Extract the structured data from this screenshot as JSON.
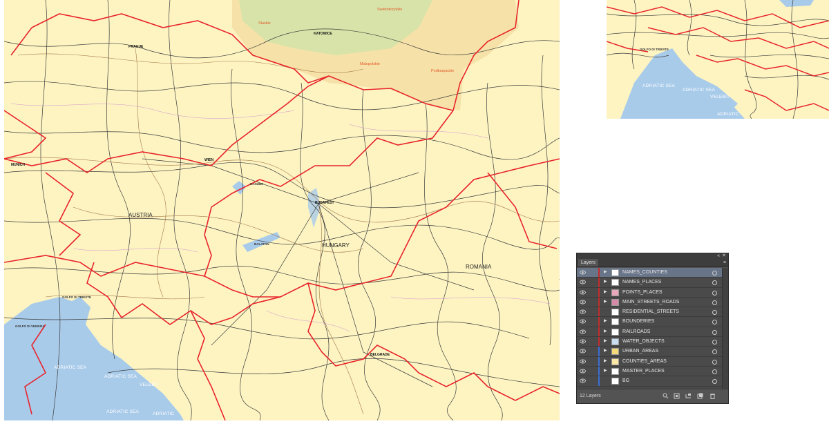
{
  "main_map": {
    "countries": [
      "AUSTRIA",
      "HUNGARY",
      "ROMANIA"
    ],
    "cities": [
      "PRAGUE",
      "KATOWICE",
      "WIEN",
      "MUNICH",
      "BUDAPEST",
      "BELGRADE"
    ],
    "regions": [
      "Slaskie",
      "Swietokrzyskie",
      "Malopolskie",
      "Podkarpackie"
    ],
    "seas": [
      "ADRIATIC SEA",
      "ADRIATIC SEA",
      "ADRIATIC"
    ],
    "places": [
      "VELEBIT",
      "DANUBE",
      "GOLFO DI TRIESTE",
      "GOLFO DI VENEZIA",
      "BALATON"
    ]
  },
  "inset_map": {
    "seas": [
      "ADRIATIC SEA",
      "ADRIATIC SEA",
      "VELEBIT",
      "ADRIATIC"
    ],
    "places": [
      "GOLFO DI TRIESTE"
    ]
  },
  "layers_panel": {
    "tab_label": "Layers",
    "collapse_glyph": "«",
    "close_glyph": "✕",
    "menu_glyph": "≡",
    "layer_count": "12 Layers",
    "layers": [
      {
        "name": "NAMES_COUNTIES",
        "bar": "#c62b2b",
        "has_arrow": true,
        "selected": true
      },
      {
        "name": "NAMES_PLACES",
        "bar": "#c62b2b",
        "has_arrow": true,
        "selected": false
      },
      {
        "name": "POINTS_PLACES",
        "bar": "#c62b2b",
        "has_arrow": true,
        "selected": false
      },
      {
        "name": "MAIN_STREETS_ROADS",
        "bar": "#c62b2b",
        "has_arrow": true,
        "selected": false
      },
      {
        "name": "RESIDENTIAL_STREETS",
        "bar": "#c62b2b",
        "has_arrow": false,
        "selected": false
      },
      {
        "name": "BOUNDERIES",
        "bar": "#c62b2b",
        "has_arrow": true,
        "selected": false
      },
      {
        "name": "RAILROADS",
        "bar": "#c62b2b",
        "has_arrow": true,
        "selected": false
      },
      {
        "name": "WATER_OBJECTS",
        "bar": "#c62b2b",
        "has_arrow": true,
        "selected": false
      },
      {
        "name": "URBAN_AREAS",
        "bar": "#3b6fd6",
        "has_arrow": true,
        "selected": false
      },
      {
        "name": "COUNTIES_AREAS",
        "bar": "#3b6fd6",
        "has_arrow": true,
        "selected": false
      },
      {
        "name": "MASTER_PLACES",
        "bar": "#3b6fd6",
        "has_arrow": true,
        "selected": false
      },
      {
        "name": "BG",
        "bar": "#3b6fd6",
        "has_arrow": false,
        "selected": false
      }
    ]
  },
  "colors": {
    "map_bg": "#fdf4c2",
    "border": "#e8232a",
    "road_dark": "#3a3a3a",
    "road_brown": "#9a6a3a",
    "road_pink": "#c97bd0",
    "water": "#a9cbea",
    "poland": "#f6e2a8",
    "forest": "#cfe3a8"
  }
}
